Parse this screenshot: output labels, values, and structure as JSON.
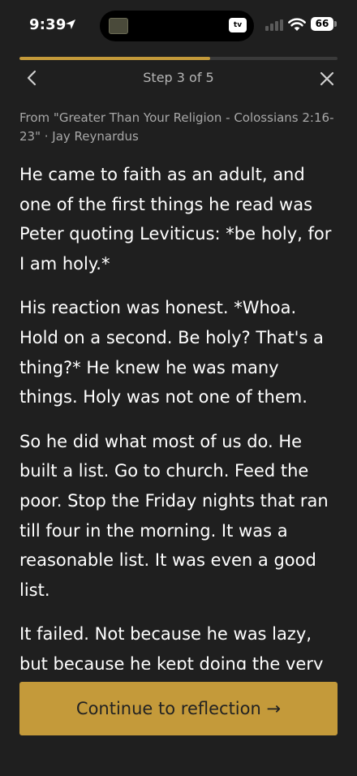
{
  "status_bar": {
    "time": "9:39",
    "battery": "66",
    "island_badge": "tv"
  },
  "progress": {
    "step_label": "Step 3 of 5",
    "fraction": 0.6
  },
  "source": {
    "text": "From \"Greater Than Your Religion - Colossians 2:16-23\" · Jay Reynardus"
  },
  "content": {
    "paragraphs": [
      "He came to faith as an adult, and one of the first things he read was Peter quoting Leviticus: *be holy, for I am holy.*",
      "His reaction was honest. *Whoa. Hold on a second. Be holy? That's a thing?* He knew he was many things. Holy was not one of them.",
      "So he did what most of us do. He built a list. Go to church. Feed the poor. Stop the Friday nights that ran till four in the morning. It was a reasonable list. It was even a good list.",
      "It failed. Not because he was lazy, but because he kept doing the very"
    ]
  },
  "cta": {
    "label": "Continue to reflection →"
  },
  "colors": {
    "background": "#1f1f1f",
    "accent": "#c49a3a",
    "track": "#3a3a3a",
    "muted_text": "#a8a8a8"
  },
  "icons": {
    "back": "chevron-left-icon",
    "close": "close-icon",
    "location": "location-arrow-icon",
    "wifi": "wifi-icon",
    "signal": "cellular-signal-icon"
  }
}
